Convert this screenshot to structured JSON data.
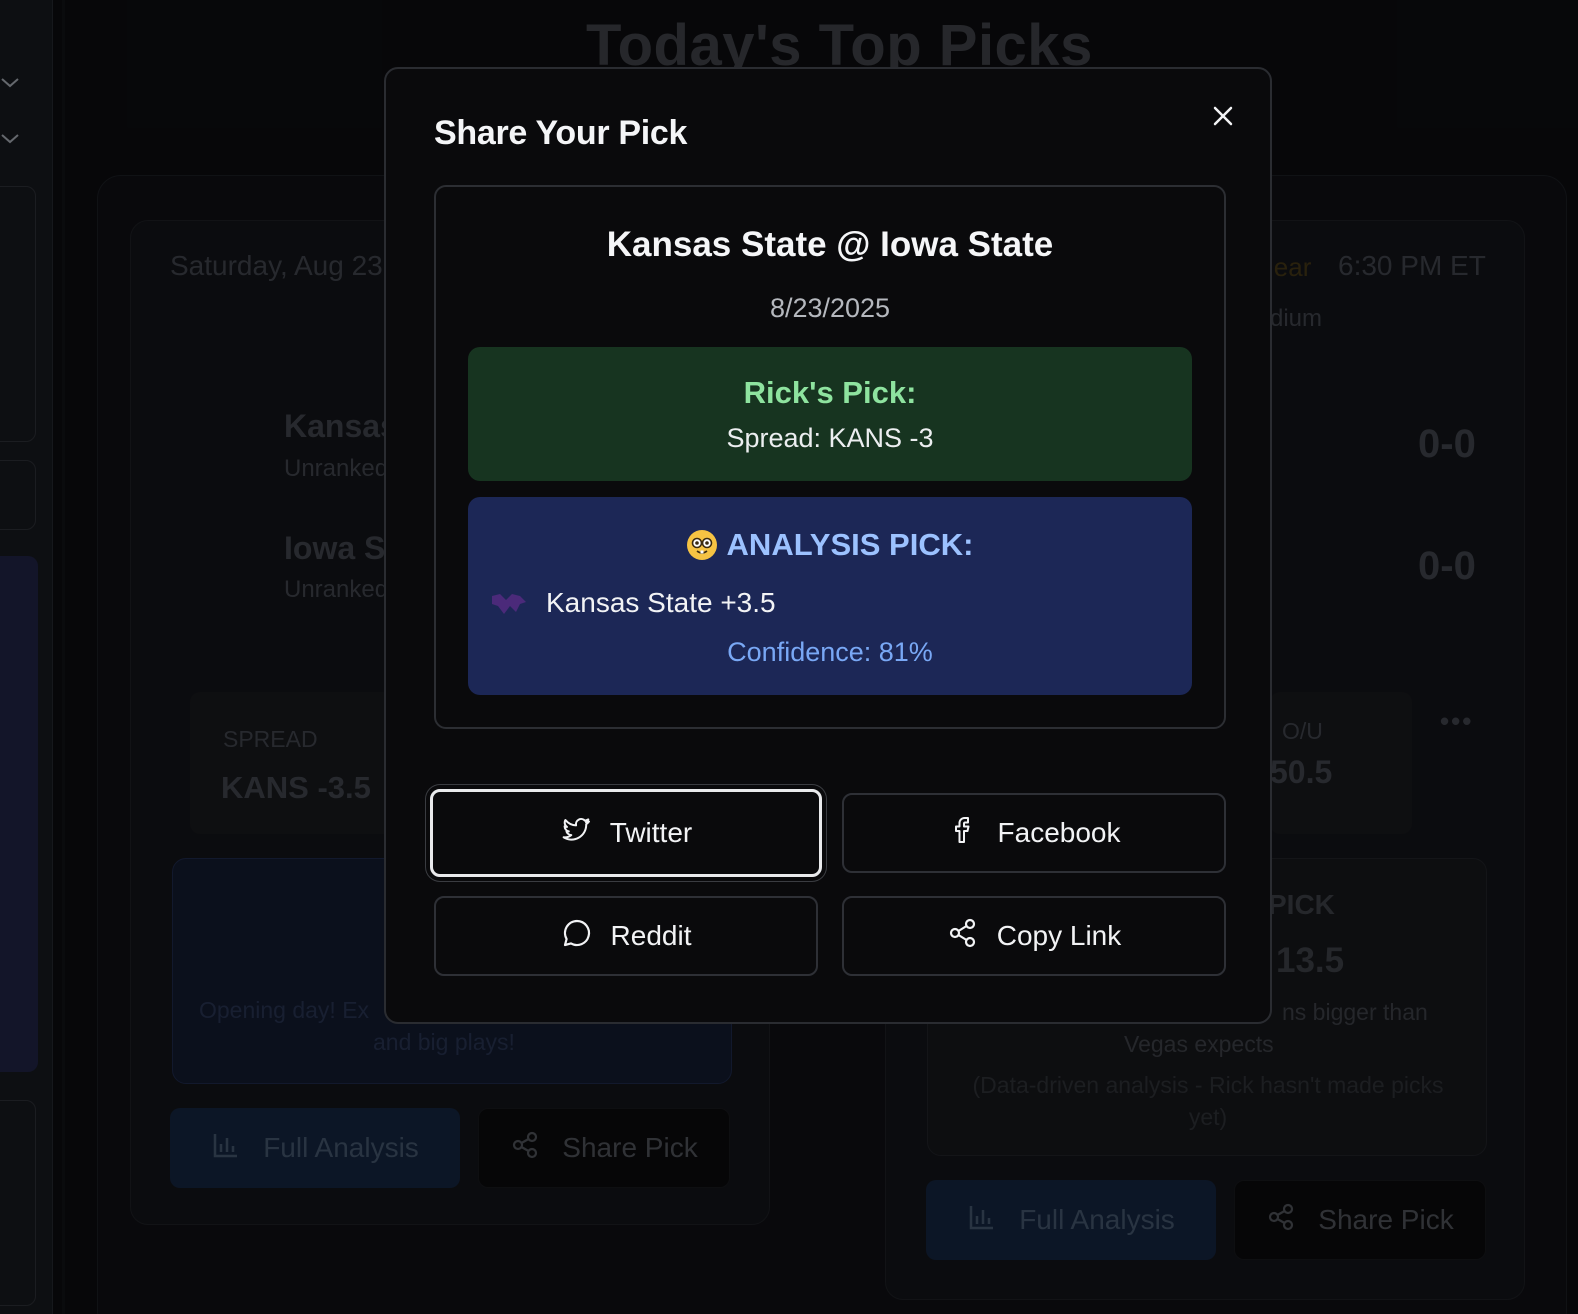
{
  "background": {
    "page_title": "Today's Top Picks",
    "left_card": {
      "date": "Saturday, Aug 23",
      "team1_name": "Kansas",
      "team1_rank": "Unranked",
      "team2_name": "Iowa S",
      "team2_rank": "Unranked",
      "spread_label": "SPREAD",
      "spread_value": "KANS -3.5",
      "analysis_text_1": "Opening day! Ex",
      "analysis_text_2": "and big plays!",
      "full_analysis": "Full Analysis",
      "share_pick": "Share Pick"
    },
    "right_card": {
      "weather": "lear",
      "time": "6:30 PM ET",
      "venue": "dium",
      "team1_record": "0-0",
      "team2_record": "0-0",
      "ou_label": "O/U",
      "ou_value": "50.5",
      "pick_label": "PICK",
      "pick_value": "13.5",
      "analysis_text_1": "ns bigger than",
      "analysis_text_2": "Vegas expects",
      "analysis_note": "(Data-driven analysis - Rick hasn't made picks yet)",
      "full_analysis": "Full Analysis",
      "share_pick": "Share Pick"
    }
  },
  "modal": {
    "title": "Share Your Pick",
    "matchup": "Kansas State @ Iowa State",
    "date": "8/23/2025",
    "rick_label": "Rick's Pick:",
    "rick_value": "Spread: KANS -3",
    "analysis_label": "ANALYSIS PICK:",
    "analysis_team": "Kansas State +3.5",
    "confidence": "Confidence: 81%",
    "buttons": {
      "twitter": "Twitter",
      "facebook": "Facebook",
      "reddit": "Reddit",
      "copy_link": "Copy Link"
    }
  },
  "colors": {
    "rick_bg": "#173420",
    "rick_text": "#8ee39f",
    "analysis_bg": "#1c2756",
    "analysis_text": "#9cc2ff",
    "confidence_text": "#79a8f5"
  }
}
